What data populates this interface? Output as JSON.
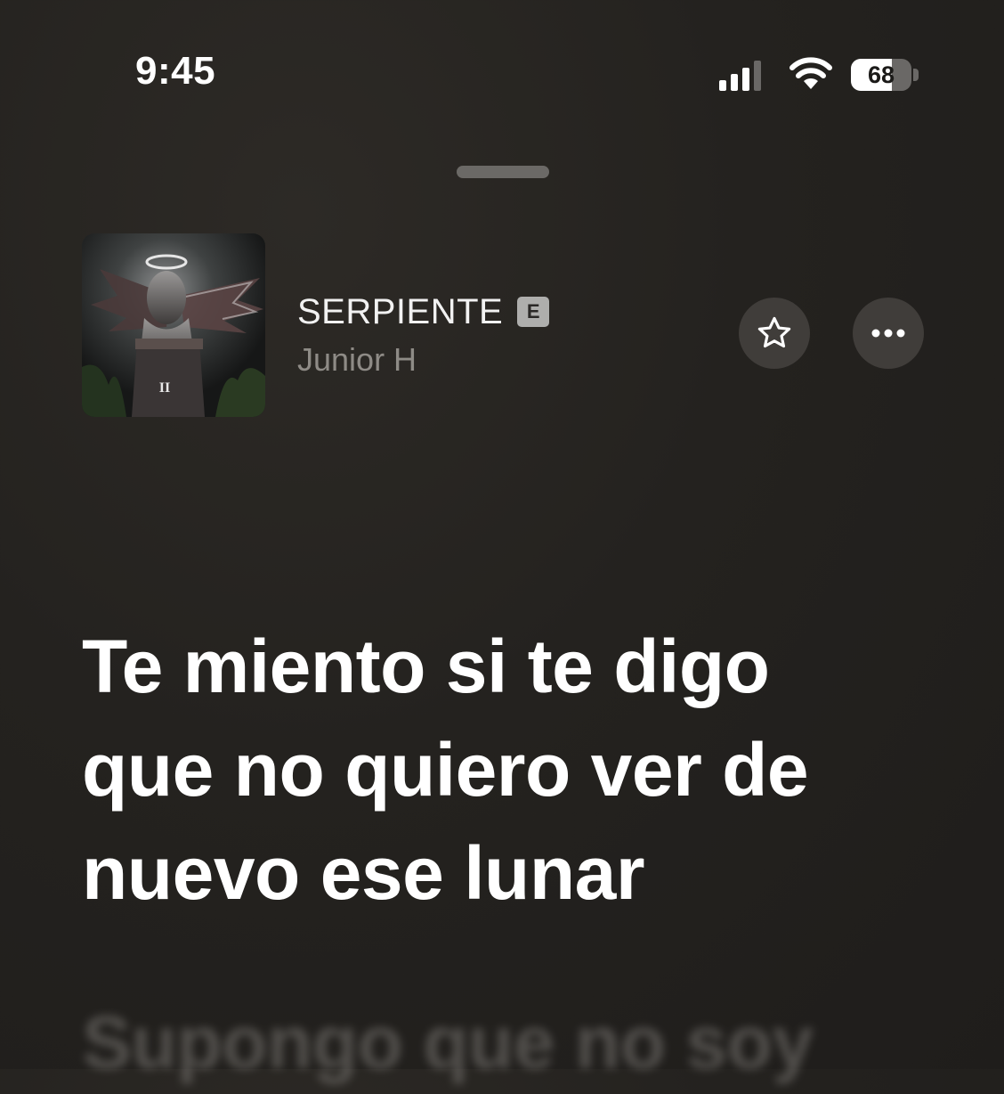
{
  "status_bar": {
    "time": "9:45",
    "battery_level": "68",
    "icons": [
      "signal-icon",
      "wifi-icon",
      "battery-icon"
    ]
  },
  "now_playing": {
    "title": "SERPIENTE",
    "explicit_badge": "E",
    "artist": "Junior H",
    "artwork_text": "II",
    "actions": [
      "star-icon",
      "more-icon"
    ]
  },
  "lyrics": {
    "current_lines": [
      "Te miento si te digo",
      "que no quiero ver de",
      "nuevo ese lunar"
    ],
    "next_line": "Supongo que no soy"
  },
  "colors": {
    "background": "#24221f",
    "secondary_text": "#8e8b86",
    "button_bg": "#403d3a",
    "badge_bg": "#aeaeac"
  }
}
